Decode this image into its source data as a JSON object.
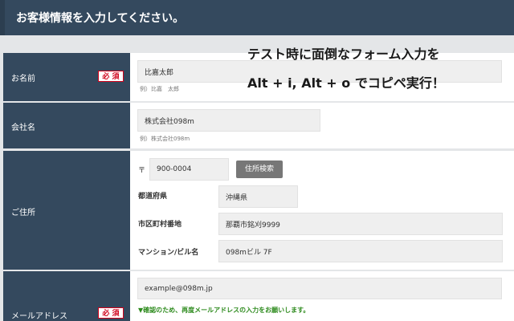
{
  "header": {
    "title": "お客様情報を入力してください。"
  },
  "overlay": {
    "line1": "テスト時に面倒なフォーム入力を",
    "line2": "Alt + i, Alt + o でコピペ実行！"
  },
  "required_label": "必 須",
  "name": {
    "label": "お名前",
    "value": "比嘉太郎",
    "example": "例）比嘉　太郎"
  },
  "company": {
    "label": "会社名",
    "value": "株式会社098m",
    "example": "例）株式会社098m"
  },
  "address": {
    "label": "ご住所",
    "postal_mark": "〒",
    "postal_value": "900-0004",
    "search_button": "住所検索",
    "prefecture_label": "都道府県",
    "prefecture_value": "沖縄県",
    "city_label": "市区町村番地",
    "city_value": "那覇市銘刈9999",
    "building_label": "マンション/ビル名",
    "building_value": "098mビル 7F"
  },
  "email": {
    "label": "メールアドレス",
    "value": "example@098m.jp",
    "confirm_note": "▼確認のため、再度メールアドレスの入力をお願いします。"
  }
}
